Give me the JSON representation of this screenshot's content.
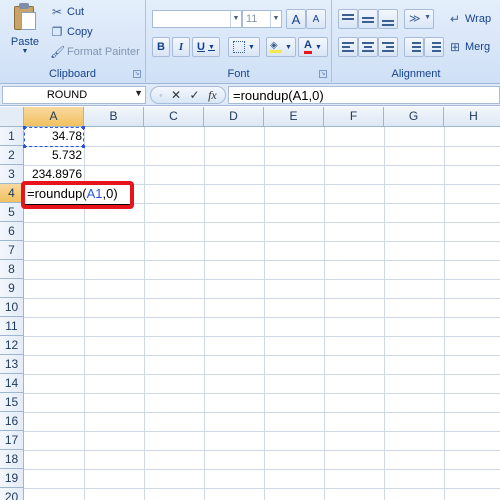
{
  "ribbon": {
    "clipboard": {
      "label": "Clipboard",
      "paste": "Paste",
      "cut": "Cut",
      "copy": "Copy",
      "format_painter": "Format Painter"
    },
    "font": {
      "label": "Font",
      "font_name": "",
      "font_size": "11",
      "grow": "A",
      "shrink": "A",
      "bold": "B",
      "italic": "I",
      "underline": "U",
      "font_color": "A"
    },
    "alignment": {
      "label": "Alignment",
      "wrap_text": "Wrap",
      "merge": "Merg"
    }
  },
  "formula_bar": {
    "name_box": "ROUND",
    "fx": "fx",
    "formula": "=roundup(A1,0)"
  },
  "columns": [
    "A",
    "B",
    "C",
    "D",
    "E",
    "F",
    "G",
    "H"
  ],
  "rows": [
    "1",
    "2",
    "3",
    "4",
    "5",
    "6",
    "7",
    "8",
    "9",
    "10",
    "11",
    "12",
    "13",
    "14",
    "15",
    "16",
    "17",
    "18",
    "19",
    "20"
  ],
  "cells": {
    "A1": "34.78",
    "A2": "5.732",
    "A3": "234.8976",
    "A4_prefix": "=roundup(",
    "A4_ref": "A1",
    "A4_suffix": ",0)"
  },
  "colors": {
    "highlight": "#e8141b",
    "reference": "#2c55d8",
    "ribbon_text": "#15428b"
  }
}
